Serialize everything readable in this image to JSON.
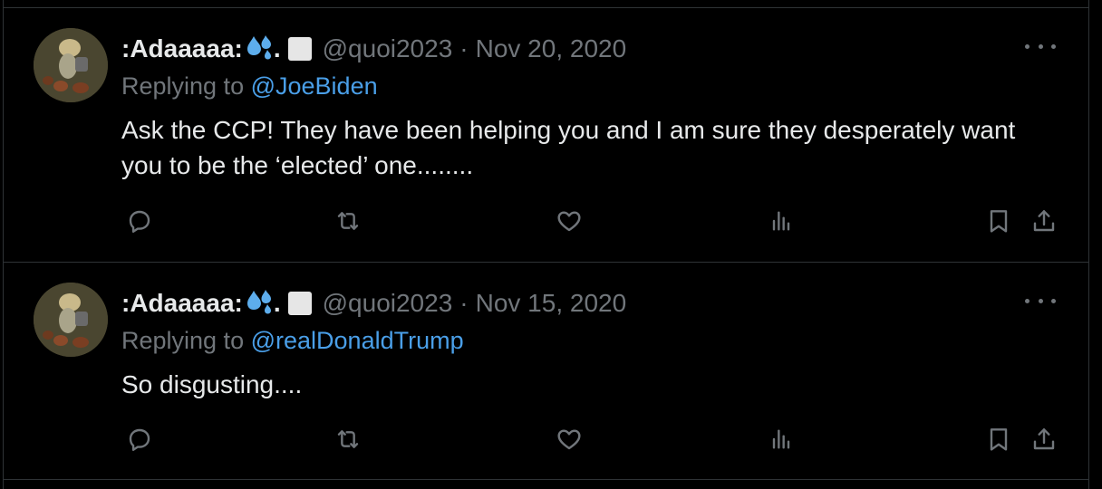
{
  "tweets": [
    {
      "display_name": ":Adaaaaa:",
      "handle": "@quoi2023",
      "separator": "·",
      "date": "Nov 20, 2020",
      "replying_prefix": "Replying to",
      "replying_to": "@JoeBiden",
      "text": "Ask the CCP! They have been helping you and I am sure they desperately want you to be the ‘elected’ one........"
    },
    {
      "display_name": ":Adaaaaa:",
      "handle": "@quoi2023",
      "separator": "·",
      "date": "Nov 15, 2020",
      "replying_prefix": "Replying to",
      "replying_to": "@realDonaldTrump",
      "text": "So disgusting...."
    }
  ],
  "emoji": {
    "drop": "sweat-droplets-icon",
    "dot": ".",
    "square": "white-square-icon"
  },
  "icons": [
    "reply-icon",
    "retweet-icon",
    "like-icon",
    "views-icon",
    "bookmark-icon",
    "share-icon",
    "more-icon"
  ],
  "colors": {
    "background": "#000000",
    "text": "#e7e9ea",
    "muted": "#71767b",
    "link": "#4a9fe8",
    "divider": "#2f3336"
  }
}
